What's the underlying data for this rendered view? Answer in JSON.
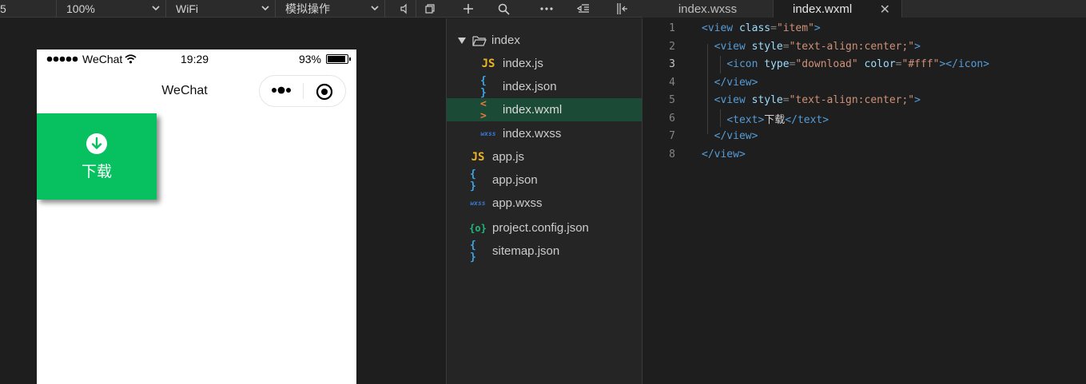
{
  "toolbar": {
    "device_suffix": "5",
    "zoom": "100%",
    "network": "WiFi",
    "operation": "模拟操作"
  },
  "tabs": [
    {
      "label": "index.wxss"
    },
    {
      "label": "index.wxml"
    }
  ],
  "simulator": {
    "status": {
      "carrier": "WeChat",
      "time": "19:29",
      "battery": "93%",
      "battery_level": 0.93
    },
    "nav_title": "WeChat",
    "card": {
      "label": "下载",
      "icon": "download-icon",
      "color": "#07c160"
    }
  },
  "file_tree": {
    "folder": "index",
    "items": [
      {
        "name": "index.js",
        "type": "js",
        "icon": "JS"
      },
      {
        "name": "index.json",
        "type": "json",
        "icon": "{ }"
      },
      {
        "name": "index.wxml",
        "type": "wxml",
        "icon": "< >"
      },
      {
        "name": "index.wxss",
        "type": "wxss",
        "icon": "wxss"
      },
      {
        "name": "app.js",
        "type": "js",
        "icon": "JS"
      },
      {
        "name": "app.json",
        "type": "json",
        "icon": "{ }"
      },
      {
        "name": "app.wxss",
        "type": "wxss",
        "icon": "wxss"
      },
      {
        "name": "project.config.json",
        "type": "cfg",
        "icon": "{o}"
      },
      {
        "name": "sitemap.json",
        "type": "json",
        "icon": "{ }"
      }
    ],
    "selected": "index.wxml"
  },
  "editor": {
    "line_numbers": [
      "1",
      "2",
      "3",
      "4",
      "5",
      "6",
      "7",
      "8"
    ],
    "current_line": "3"
  },
  "colors": {
    "accent_green": "#07c160",
    "selection": "#1b4a36"
  }
}
